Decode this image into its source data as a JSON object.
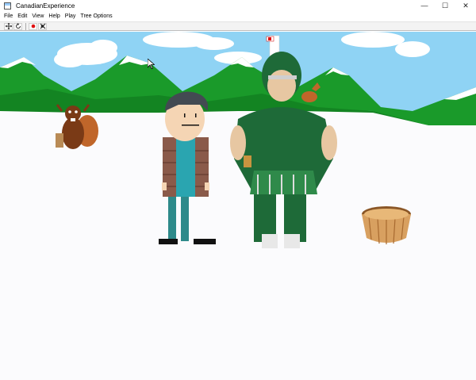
{
  "window": {
    "title": "CanadianExperience",
    "controls": {
      "minimize": "—",
      "maximize": "☐",
      "close": "✕"
    }
  },
  "menubar": {
    "items": [
      "File",
      "Edit",
      "View",
      "Help",
      "Play",
      "Tree Options"
    ]
  },
  "toolbar": {
    "icons": [
      "select-tool-icon",
      "rotate-tool-icon",
      "record-icon",
      "delete-keyframe-icon"
    ]
  },
  "scene": {
    "sky_color": "#8fd3f4",
    "mountain_color": "#1a9a2a",
    "snow_color": "#fbfbfd",
    "characters": [
      "terrance-character",
      "spartan-mascot",
      "beaver-figure",
      "moose-figure",
      "basket-prop"
    ]
  }
}
